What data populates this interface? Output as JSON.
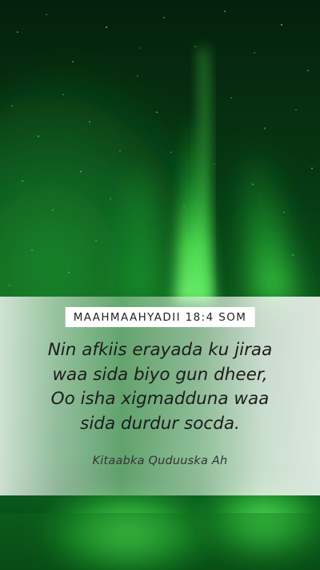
{
  "card": {
    "reference": "MAAHMAAHYADII 18:4 SOM",
    "verse_lines": [
      "Nin afkiis erayada ku jiraa",
      "waa sida biyo gun dheer,",
      "Oo isha xigmadduna waa",
      "sida durdur socda."
    ],
    "version": "Kitaabka Quduuska Ah"
  },
  "background": {
    "subject": "green aurora borealis over starry night sky",
    "colors": {
      "sky_dark": "#041f0c",
      "aurora_green": "#27d43a",
      "aurora_glow": "#7bff7a"
    }
  }
}
